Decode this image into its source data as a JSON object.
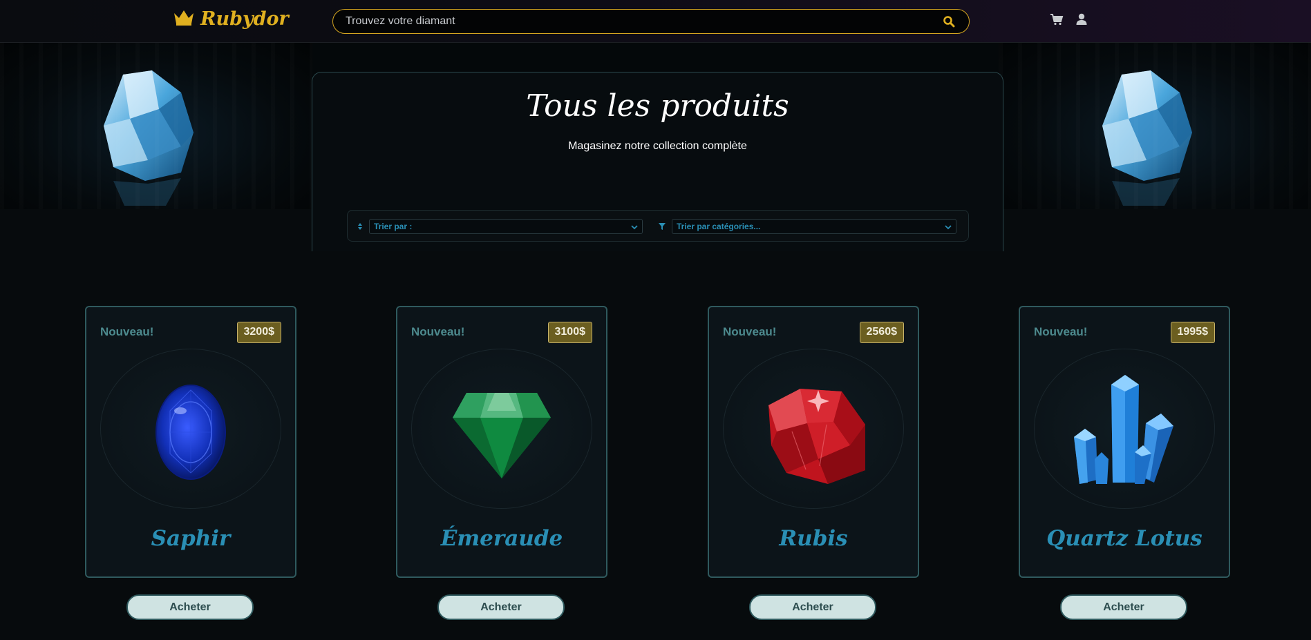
{
  "header": {
    "brand": "Rubydor",
    "search_placeholder": "Trouvez votre diamant",
    "accent_color": "#e0b020"
  },
  "hero": {
    "title": "Tous les produits",
    "subtitle": "Magasinez notre collection complète"
  },
  "filters": {
    "sort_label": "Trier par :",
    "category_label": "Trier par catégories..."
  },
  "products": [
    {
      "badge": "Nouveau!",
      "price": "3200$",
      "name": "Saphir",
      "button": "Acheter",
      "icon": "sapphire-gem"
    },
    {
      "badge": "Nouveau!",
      "price": "3100$",
      "name": "Émeraude",
      "button": "Acheter",
      "icon": "emerald-gem"
    },
    {
      "badge": "Nouveau!",
      "price": "2560$",
      "name": "Rubis",
      "button": "Acheter",
      "icon": "ruby-gem"
    },
    {
      "badge": "Nouveau!",
      "price": "1995$",
      "name": "Quartz Lotus",
      "button": "Acheter",
      "icon": "quartz-crystal"
    }
  ],
  "colors": {
    "product_name": "#2a8fb5",
    "card_border": "#2f5a5e",
    "price_badge": "#6b5e20",
    "button_bg": "#cfe3e2"
  }
}
